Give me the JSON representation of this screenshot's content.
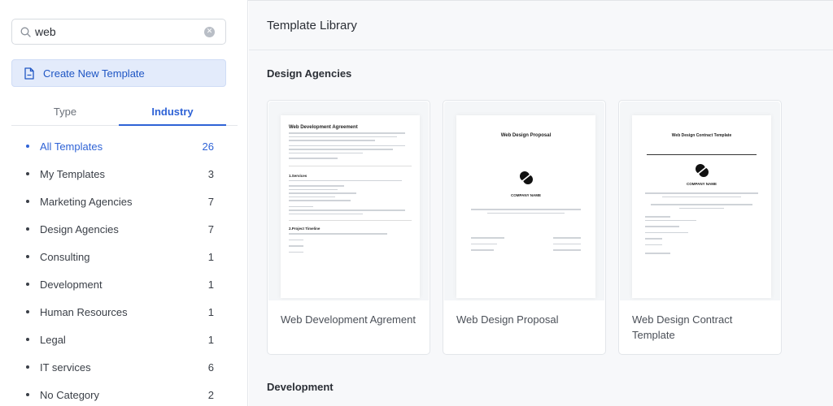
{
  "sidebar": {
    "search": {
      "value": "web",
      "placeholder": ""
    },
    "create_button": "Create New Template",
    "tabs": [
      {
        "label": "Type",
        "active": false
      },
      {
        "label": "Industry",
        "active": true
      }
    ],
    "categories": [
      {
        "name": "All Templates",
        "count": "26",
        "active": true
      },
      {
        "name": "My Templates",
        "count": "3"
      },
      {
        "name": "Marketing Agencies",
        "count": "7"
      },
      {
        "name": "Design Agencies",
        "count": "7"
      },
      {
        "name": "Consulting",
        "count": "1"
      },
      {
        "name": "Development",
        "count": "1"
      },
      {
        "name": "Human Resources",
        "count": "1"
      },
      {
        "name": "Legal",
        "count": "1"
      },
      {
        "name": "IT services",
        "count": "6"
      },
      {
        "name": "No Category",
        "count": "2"
      }
    ]
  },
  "main": {
    "title": "Template Library",
    "sections": [
      {
        "title": "Design Agencies",
        "cards": [
          {
            "title": "Web Development Agrement",
            "thumb": {
              "heading": "Web Development Agreement",
              "h1": "1.Services",
              "h2": "2.Project Timeline"
            }
          },
          {
            "title": "Web Design Proposal",
            "thumb": {
              "heading": "Web Design Proposal",
              "company": "COMPANY NAME"
            }
          },
          {
            "title": "Web Design Contract Template",
            "thumb": {
              "heading": "Web Design Contract Template",
              "company": "COMPANY NAME"
            }
          }
        ]
      },
      {
        "title": "Development"
      }
    ]
  },
  "colors": {
    "accent": "#2f63d6",
    "create_button_bg": "#e3ebfb",
    "main_bg": "#f7f8fa"
  }
}
